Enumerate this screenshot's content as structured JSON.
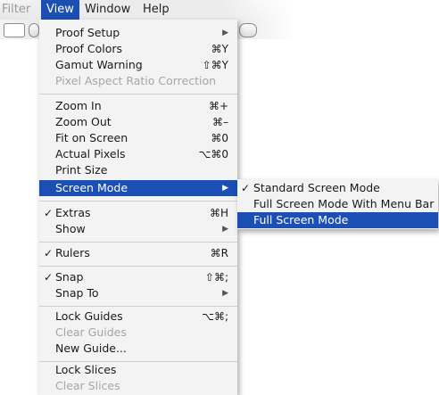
{
  "menubar": {
    "items": [
      {
        "label": "Filter"
      },
      {
        "label": "View"
      },
      {
        "label": "Window"
      },
      {
        "label": "Help"
      }
    ]
  },
  "colors": {
    "highlight": "#1c4fb3",
    "menu_background": "#f3f3f3",
    "disabled_text": "#a6a6a6"
  },
  "view_menu": {
    "items": [
      {
        "label": "Proof Setup",
        "submenu_icon": "triangle-right-icon"
      },
      {
        "label": "Proof Colors",
        "shortcut": "⌘Y"
      },
      {
        "label": "Gamut Warning",
        "shortcut": "⇧⌘Y"
      },
      {
        "label": "Pixel Aspect Ratio Correction",
        "disabled": true
      },
      {
        "label": "Zoom In",
        "shortcut": "⌘+"
      },
      {
        "label": "Zoom Out",
        "shortcut": "⌘–"
      },
      {
        "label": "Fit on Screen",
        "shortcut": "⌘0"
      },
      {
        "label": "Actual Pixels",
        "shortcut": "⌥⌘0"
      },
      {
        "label": "Print Size"
      },
      {
        "label": "Screen Mode",
        "selected": true,
        "submenu_icon": "triangle-right-icon"
      },
      {
        "label": "Extras",
        "shortcut": "⌘H",
        "checked": true
      },
      {
        "label": "Show",
        "submenu_icon": "triangle-right-icon"
      },
      {
        "label": "Rulers",
        "shortcut": "⌘R",
        "checked": true
      },
      {
        "label": "Snap",
        "shortcut": "⇧⌘;",
        "checked": true
      },
      {
        "label": "Snap To",
        "submenu_icon": "triangle-right-icon"
      },
      {
        "label": "Lock Guides",
        "shortcut": "⌥⌘;"
      },
      {
        "label": "Clear Guides",
        "disabled": true
      },
      {
        "label": "New Guide..."
      },
      {
        "label": "Lock Slices"
      },
      {
        "label": "Clear Slices",
        "disabled": true
      }
    ],
    "check_mark": "✓",
    "arrow_glyph": "▶"
  },
  "screen_mode_submenu": {
    "items": [
      {
        "label": "Standard Screen Mode",
        "checked": true
      },
      {
        "label": "Full Screen Mode With Menu Bar"
      },
      {
        "label": "Full Screen Mode",
        "selected": true
      }
    ]
  }
}
